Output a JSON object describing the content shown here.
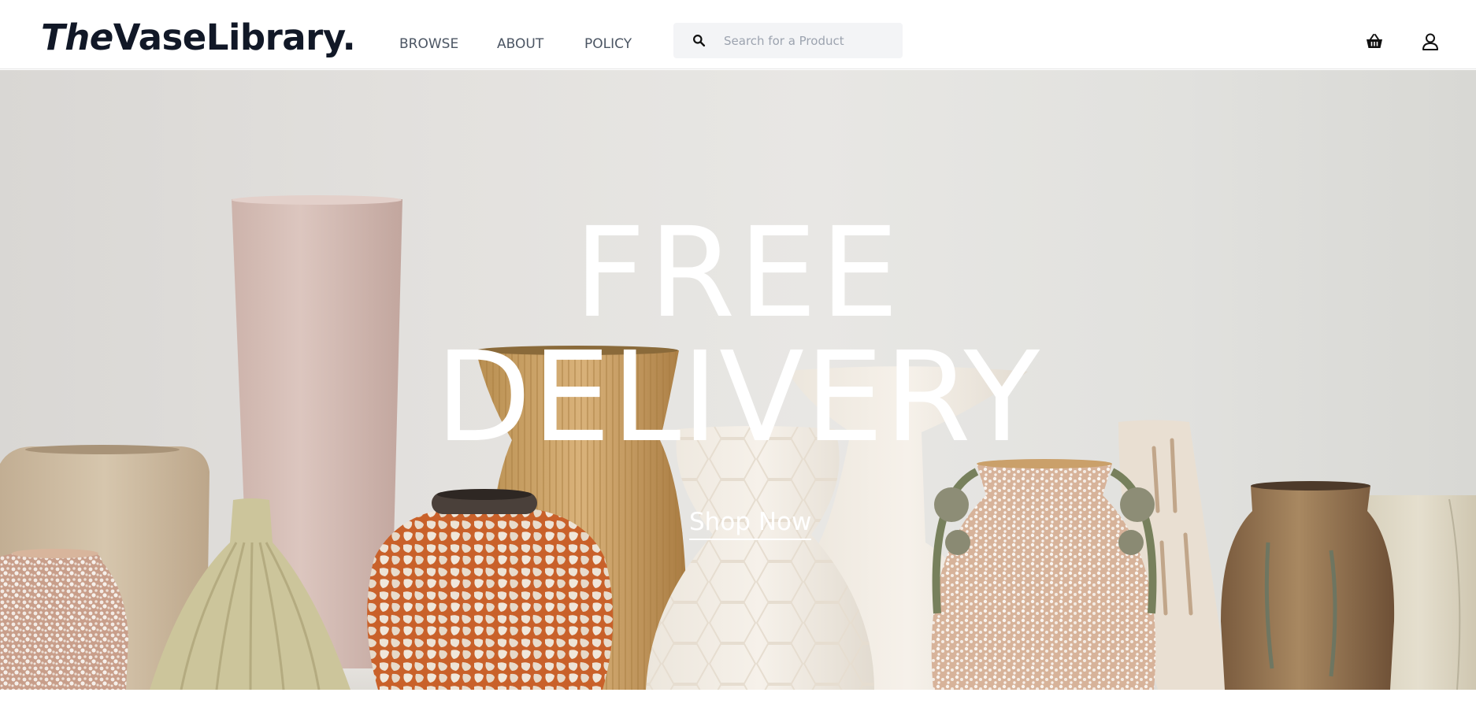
{
  "brand": {
    "logo_prefix": "The",
    "logo_suffix": "VaseLibrary."
  },
  "nav": {
    "items": [
      {
        "label": "BROWSE"
      },
      {
        "label": "ABOUT"
      },
      {
        "label": "POLICY"
      }
    ]
  },
  "search": {
    "placeholder": "Search for a Product",
    "value": ""
  },
  "icons": {
    "search": "search-icon",
    "cart": "basket-icon",
    "account": "user-icon"
  },
  "hero": {
    "line1": "FREE",
    "line2": "DELIVERY",
    "cta": "Shop Now"
  },
  "colors": {
    "text_dark": "#111827",
    "nav_text": "#4b5563",
    "search_bg": "#f3f4f6",
    "hero_text": "#ffffff"
  }
}
